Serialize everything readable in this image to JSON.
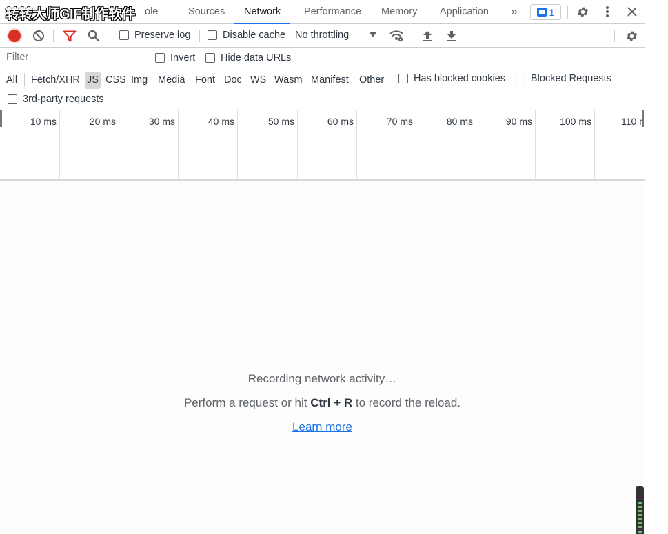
{
  "watermark": "转转大师GIF制作软件",
  "tabs": {
    "partial": "ole",
    "sources": "Sources",
    "network": "Network",
    "performance": "Performance",
    "memory": "Memory",
    "application": "Application",
    "more": "»",
    "issues_count": "1"
  },
  "toolbar": {
    "preserve_log": "Preserve log",
    "disable_cache": "Disable cache",
    "throttling": "No throttling"
  },
  "filter": {
    "placeholder": "Filter",
    "invert": "Invert",
    "hide_data_urls": "Hide data URLs"
  },
  "types": {
    "all": "All",
    "fetch_xhr": "Fetch/XHR",
    "js": "JS",
    "css": "CSS",
    "img": "Img",
    "media": "Media",
    "font": "Font",
    "doc": "Doc",
    "ws": "WS",
    "wasm": "Wasm",
    "manifest": "Manifest",
    "other": "Other",
    "has_blocked_cookies": "Has blocked cookies",
    "blocked_requests": "Blocked Requests",
    "third_party": "3rd-party requests"
  },
  "timeline": {
    "ticks": [
      "10 ms",
      "20 ms",
      "30 ms",
      "40 ms",
      "50 ms",
      "60 ms",
      "70 ms",
      "80 ms",
      "90 ms",
      "100 ms",
      "110 r"
    ]
  },
  "empty_state": {
    "recording": "Recording network activity…",
    "perform_prefix": "Perform a request or hit ",
    "shortcut": "Ctrl + R",
    "perform_suffix": " to record the reload.",
    "learn_more": "Learn more"
  },
  "colors": {
    "accent": "#1a73e8",
    "record": "#d93025",
    "filter_icon": "#d93025"
  }
}
